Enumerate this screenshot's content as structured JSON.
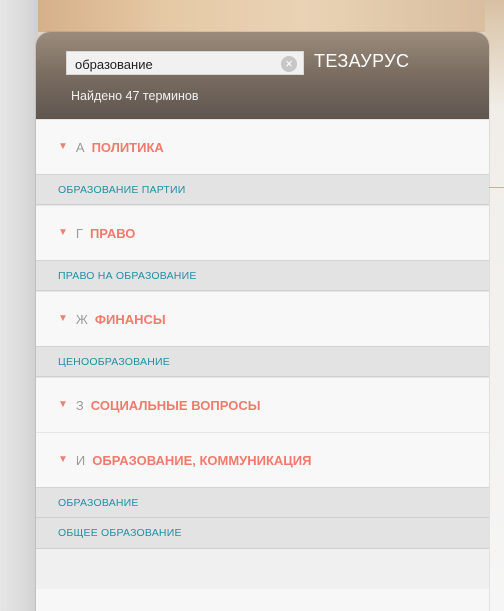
{
  "search": {
    "value": "образование",
    "clear_icon": "×"
  },
  "panel": {
    "title": "ТЕЗАУРУС",
    "results_count": "Найдено 47 терминов"
  },
  "icons": {
    "chevron": "▼"
  },
  "sections": [
    {
      "letter": "А",
      "title": "ПОЛИТИКА",
      "terms": [
        "ОБРАЗОВАНИЕ ПАРТИИ"
      ]
    },
    {
      "letter": "Г",
      "title": "ПРАВО",
      "terms": [
        "ПРАВО НА ОБРАЗОВАНИЕ"
      ]
    },
    {
      "letter": "Ж",
      "title": "ФИНАНСЫ",
      "terms": [
        "ЦЕНООБРАЗОВАНИЕ"
      ]
    },
    {
      "letter": "З",
      "title": "СОЦИАЛЬНЫЕ ВОПРОСЫ",
      "terms": []
    },
    {
      "letter": "И",
      "title": "ОБРАЗОВАНИЕ, КОММУНИКАЦИЯ",
      "terms": [
        "ОБРАЗОВАНИЕ",
        "ОБЩЕЕ ОБРАЗОВАНИЕ"
      ]
    }
  ],
  "colors": {
    "accent_red": "#f17a6d",
    "term_blue": "#1f8fa5"
  }
}
